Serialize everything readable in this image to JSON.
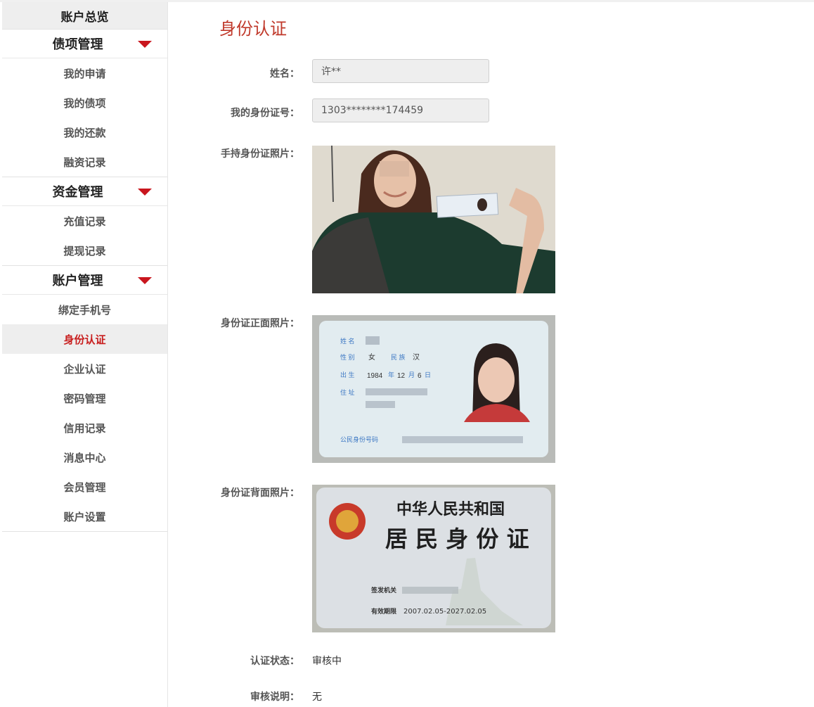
{
  "sidebar": {
    "overview": "账户总览",
    "groups": [
      {
        "label": "债项管理",
        "items": [
          "我的申请",
          "我的债项",
          "我的还款",
          "融资记录"
        ]
      },
      {
        "label": "资金管理",
        "items": [
          "充值记录",
          "提现记录"
        ]
      },
      {
        "label": "账户管理",
        "items": [
          "绑定手机号",
          "身份认证",
          "企业认证",
          "密码管理",
          "信用记录",
          "消息中心",
          "会员管理",
          "账户设置"
        ]
      }
    ],
    "active_item": "身份认证"
  },
  "page": {
    "title": "身份认证",
    "name_label": "姓名：",
    "name_value": "许**",
    "id_label": "我的身份证号：",
    "id_value": "1303********174459",
    "hold_photo_label": "手持身份证照片：",
    "front_photo_label": "身份证正面照片：",
    "back_photo_label": "身份证背面照片：",
    "status_label": "认证状态：",
    "status_value": "审核中",
    "remark_label": "审核说明：",
    "remark_value": "无"
  },
  "id_card_front": {
    "name_field": "姓 名",
    "sex_field": "性 别",
    "sex_value": "女",
    "ethnic_field": "民 族",
    "ethnic_value": "汉",
    "birth_field": "出 生",
    "birth_year": "1984",
    "year_unit": "年",
    "birth_month": "12",
    "month_unit": "月",
    "birth_day": "6",
    "day_unit": "日",
    "address_field": "住 址",
    "id_number_field": "公民身份号码"
  },
  "id_card_back": {
    "country": "中华人民共和国",
    "card_title": "居 民 身 份 证",
    "issuer_field": "签发机关",
    "validity_field": "有效期限",
    "validity_value": "2007.02.05-2027.02.05"
  },
  "colors": {
    "accent": "#c81e1e",
    "active_bg": "#eeeeee"
  }
}
